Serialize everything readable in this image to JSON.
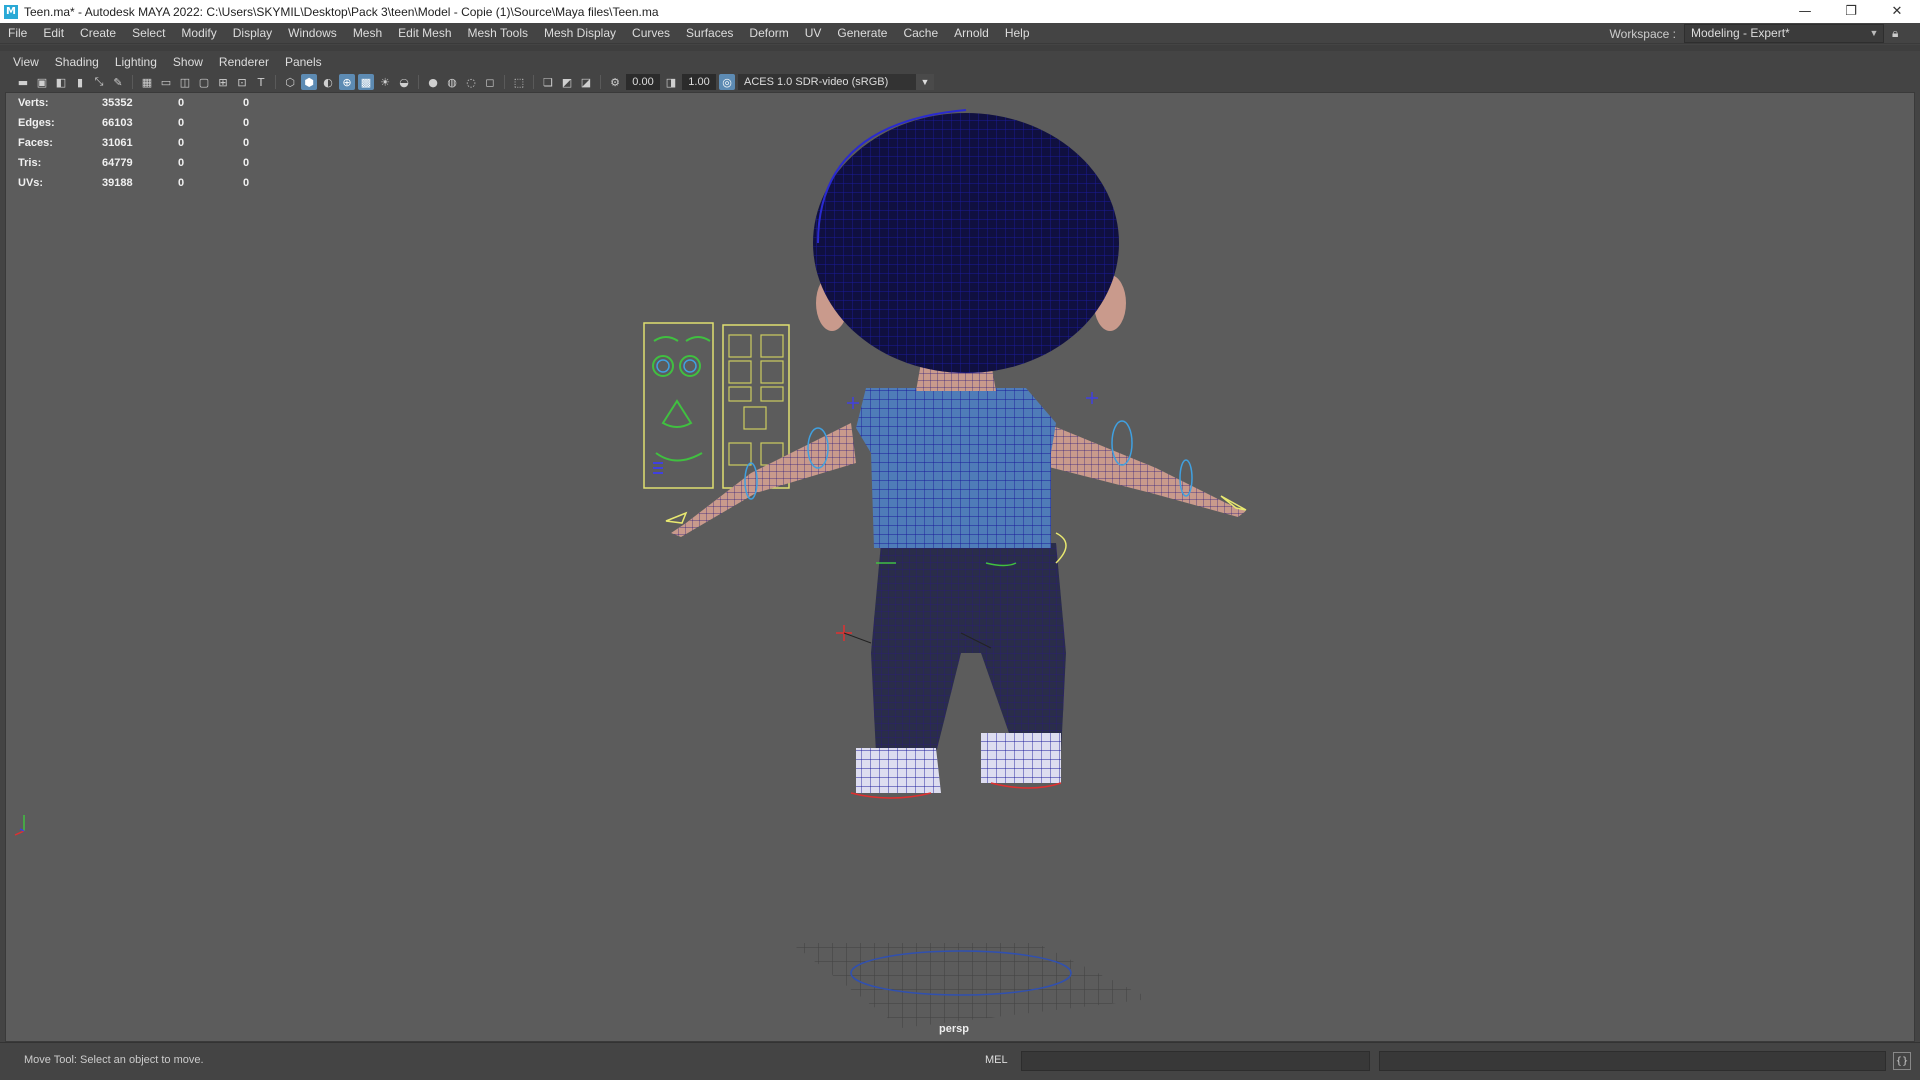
{
  "window": {
    "title": "Teen.ma* - Autodesk MAYA 2022: C:\\Users\\SKYMIL\\Desktop\\Pack 3\\teen\\Model - Copie (1)\\Source\\Maya files\\Teen.ma",
    "app_icon_letter": "M",
    "minimize": "—",
    "restore": "❐",
    "close": "✕"
  },
  "menubar": {
    "items": [
      "File",
      "Edit",
      "Create",
      "Select",
      "Modify",
      "Display",
      "Windows",
      "Mesh",
      "Edit Mesh",
      "Mesh Tools",
      "Mesh Display",
      "Curves",
      "Surfaces",
      "Deform",
      "UV",
      "Generate",
      "Cache",
      "Arnold",
      "Help"
    ],
    "workspace_label": "Workspace :",
    "workspace_value": "Modeling - Expert*"
  },
  "panel_menu": {
    "items": [
      "View",
      "Shading",
      "Lighting",
      "Show",
      "Renderer",
      "Panels"
    ]
  },
  "panel_toolbar": {
    "exposure_value": "0.00",
    "gamma_value": "1.00",
    "color_space": "ACES 1.0 SDR-video (sRGB)"
  },
  "hud": {
    "rows": [
      {
        "label": "Verts:",
        "value": "35352",
        "c1": "0",
        "c2": "0"
      },
      {
        "label": "Edges:",
        "value": "66103",
        "c1": "0",
        "c2": "0"
      },
      {
        "label": "Faces:",
        "value": "31061",
        "c1": "0",
        "c2": "0"
      },
      {
        "label": "Tris:",
        "value": "64779",
        "c1": "0",
        "c2": "0"
      },
      {
        "label": "UVs:",
        "value": "39188",
        "c1": "0",
        "c2": "0"
      }
    ]
  },
  "viewport": {
    "camera_label": "persp"
  },
  "statusbar": {
    "help_line": "Move Tool: Select an object to move.",
    "mel_label": "MEL",
    "command_value": ""
  },
  "colors": {
    "viewport_bg": "#5c5c5c",
    "wire_blue": "#1a1aa0",
    "shirt_blue": "#4a78b8",
    "skin": "#c89a8a",
    "rig_yellow": "#e8e870",
    "rig_green": "#40d040"
  }
}
